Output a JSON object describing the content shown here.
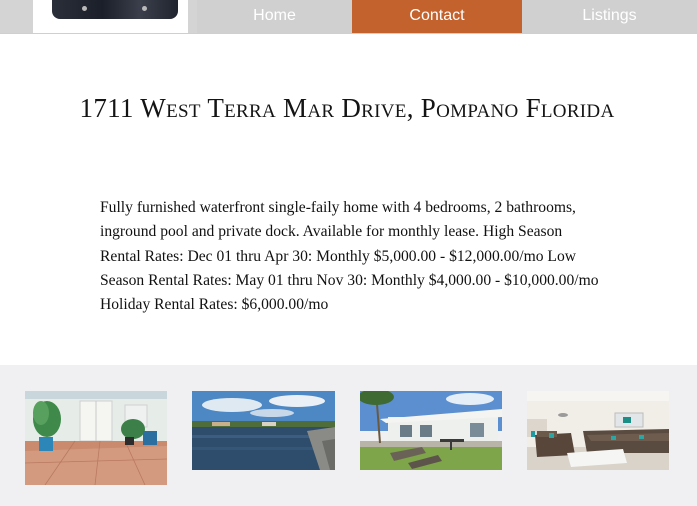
{
  "nav": {
    "items": [
      {
        "label": "Home"
      },
      {
        "label": "Contact"
      },
      {
        "label": "Listings"
      }
    ],
    "active": "Contact",
    "accent_color": "#c4622d"
  },
  "listing": {
    "title": "1711 West Terra Mar Drive, Pompano Florida",
    "description": "Fully furnished waterfront single-faily home with 4 bedrooms, 2 bathrooms, inground pool and private dock. Available for monthly lease. High Season Rental Rates: Dec 01 thru Apr 30: Monthly $5,000.00 - $12,000.00/mo Low Season Rental Rates: May 01 thru Nov 30: Monthly $4,000.00 - $10,000.00/mo Holiday Rental Rates: $6,000.00/mo"
  },
  "gallery": {
    "photos": [
      {
        "subject": "patio with potted palms and french doors"
      },
      {
        "subject": "canal waterfront view"
      },
      {
        "subject": "backyard with lounge chairs and palm tree"
      },
      {
        "subject": "living room with sectional sofa"
      }
    ]
  }
}
